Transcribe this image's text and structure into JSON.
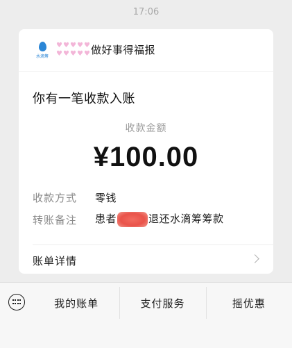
{
  "timestamp": "17:06",
  "message": {
    "logo_text": "水滴筹",
    "sender_decoration": "♥♥♥♥♥♥♥♥♥♥",
    "sender_name": "做好事得福报",
    "notice": "你有一笔收款入账",
    "amount_label": "收款金额",
    "amount": "¥100.00",
    "rows": [
      {
        "label": "收款方式",
        "value_before": "零钱",
        "value_after": ""
      },
      {
        "label": "转账备注",
        "value_before": "患者",
        "value_after": "退还水滴筹筹款"
      }
    ],
    "detail_label": "账单详情"
  },
  "bottom_menu": {
    "items": [
      "我的账单",
      "支付服务",
      "摇优惠"
    ]
  },
  "colors": {
    "background": "#ededed",
    "card": "#ffffff",
    "secondary_text": "#8a8a8a",
    "redaction": "#e9534a"
  }
}
